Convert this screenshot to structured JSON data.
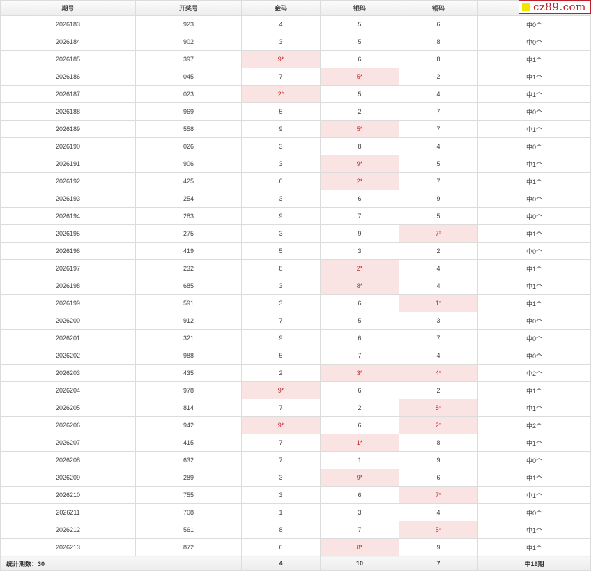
{
  "headers": [
    "期号",
    "开奖号",
    "金码",
    "银码",
    "铜码",
    ""
  ],
  "rows": [
    {
      "issue": "2026183",
      "number": "923",
      "gold": {
        "v": "4",
        "hit": false
      },
      "silver": {
        "v": "5",
        "hit": false
      },
      "bronze": {
        "v": "6",
        "hit": false
      },
      "result": "中0个"
    },
    {
      "issue": "2026184",
      "number": "902",
      "gold": {
        "v": "3",
        "hit": false
      },
      "silver": {
        "v": "5",
        "hit": false
      },
      "bronze": {
        "v": "8",
        "hit": false
      },
      "result": "中0个"
    },
    {
      "issue": "2026185",
      "number": "397",
      "gold": {
        "v": "9*",
        "hit": true
      },
      "silver": {
        "v": "6",
        "hit": false
      },
      "bronze": {
        "v": "8",
        "hit": false
      },
      "result": "中1个"
    },
    {
      "issue": "2026186",
      "number": "045",
      "gold": {
        "v": "7",
        "hit": false
      },
      "silver": {
        "v": "5*",
        "hit": true
      },
      "bronze": {
        "v": "2",
        "hit": false
      },
      "result": "中1个"
    },
    {
      "issue": "2026187",
      "number": "023",
      "gold": {
        "v": "2*",
        "hit": true
      },
      "silver": {
        "v": "5",
        "hit": false
      },
      "bronze": {
        "v": "4",
        "hit": false
      },
      "result": "中1个"
    },
    {
      "issue": "2026188",
      "number": "969",
      "gold": {
        "v": "5",
        "hit": false
      },
      "silver": {
        "v": "2",
        "hit": false
      },
      "bronze": {
        "v": "7",
        "hit": false
      },
      "result": "中0个"
    },
    {
      "issue": "2026189",
      "number": "558",
      "gold": {
        "v": "9",
        "hit": false
      },
      "silver": {
        "v": "5*",
        "hit": true
      },
      "bronze": {
        "v": "7",
        "hit": false
      },
      "result": "中1个"
    },
    {
      "issue": "2026190",
      "number": "026",
      "gold": {
        "v": "3",
        "hit": false
      },
      "silver": {
        "v": "8",
        "hit": false
      },
      "bronze": {
        "v": "4",
        "hit": false
      },
      "result": "中0个"
    },
    {
      "issue": "2026191",
      "number": "906",
      "gold": {
        "v": "3",
        "hit": false
      },
      "silver": {
        "v": "9*",
        "hit": true
      },
      "bronze": {
        "v": "5",
        "hit": false
      },
      "result": "中1个"
    },
    {
      "issue": "2026192",
      "number": "425",
      "gold": {
        "v": "6",
        "hit": false
      },
      "silver": {
        "v": "2*",
        "hit": true
      },
      "bronze": {
        "v": "7",
        "hit": false
      },
      "result": "中1个"
    },
    {
      "issue": "2026193",
      "number": "254",
      "gold": {
        "v": "3",
        "hit": false
      },
      "silver": {
        "v": "6",
        "hit": false
      },
      "bronze": {
        "v": "9",
        "hit": false
      },
      "result": "中0个"
    },
    {
      "issue": "2026194",
      "number": "283",
      "gold": {
        "v": "9",
        "hit": false
      },
      "silver": {
        "v": "7",
        "hit": false
      },
      "bronze": {
        "v": "5",
        "hit": false
      },
      "result": "中0个"
    },
    {
      "issue": "2026195",
      "number": "275",
      "gold": {
        "v": "3",
        "hit": false
      },
      "silver": {
        "v": "9",
        "hit": false
      },
      "bronze": {
        "v": "7*",
        "hit": true
      },
      "result": "中1个"
    },
    {
      "issue": "2026196",
      "number": "419",
      "gold": {
        "v": "5",
        "hit": false
      },
      "silver": {
        "v": "3",
        "hit": false
      },
      "bronze": {
        "v": "2",
        "hit": false
      },
      "result": "中0个"
    },
    {
      "issue": "2026197",
      "number": "232",
      "gold": {
        "v": "8",
        "hit": false
      },
      "silver": {
        "v": "2*",
        "hit": true
      },
      "bronze": {
        "v": "4",
        "hit": false
      },
      "result": "中1个"
    },
    {
      "issue": "2026198",
      "number": "685",
      "gold": {
        "v": "3",
        "hit": false
      },
      "silver": {
        "v": "8*",
        "hit": true
      },
      "bronze": {
        "v": "4",
        "hit": false
      },
      "result": "中1个"
    },
    {
      "issue": "2026199",
      "number": "591",
      "gold": {
        "v": "3",
        "hit": false
      },
      "silver": {
        "v": "6",
        "hit": false
      },
      "bronze": {
        "v": "1*",
        "hit": true
      },
      "result": "中1个"
    },
    {
      "issue": "2026200",
      "number": "912",
      "gold": {
        "v": "7",
        "hit": false
      },
      "silver": {
        "v": "5",
        "hit": false
      },
      "bronze": {
        "v": "3",
        "hit": false
      },
      "result": "中0个"
    },
    {
      "issue": "2026201",
      "number": "321",
      "gold": {
        "v": "9",
        "hit": false
      },
      "silver": {
        "v": "6",
        "hit": false
      },
      "bronze": {
        "v": "7",
        "hit": false
      },
      "result": "中0个"
    },
    {
      "issue": "2026202",
      "number": "988",
      "gold": {
        "v": "5",
        "hit": false
      },
      "silver": {
        "v": "7",
        "hit": false
      },
      "bronze": {
        "v": "4",
        "hit": false
      },
      "result": "中0个"
    },
    {
      "issue": "2026203",
      "number": "435",
      "gold": {
        "v": "2",
        "hit": false
      },
      "silver": {
        "v": "3*",
        "hit": true
      },
      "bronze": {
        "v": "4*",
        "hit": true
      },
      "result": "中2个"
    },
    {
      "issue": "2026204",
      "number": "978",
      "gold": {
        "v": "9*",
        "hit": true
      },
      "silver": {
        "v": "6",
        "hit": false
      },
      "bronze": {
        "v": "2",
        "hit": false
      },
      "result": "中1个"
    },
    {
      "issue": "2026205",
      "number": "814",
      "gold": {
        "v": "7",
        "hit": false
      },
      "silver": {
        "v": "2",
        "hit": false
      },
      "bronze": {
        "v": "8*",
        "hit": true
      },
      "result": "中1个"
    },
    {
      "issue": "2026206",
      "number": "942",
      "gold": {
        "v": "9*",
        "hit": true
      },
      "silver": {
        "v": "6",
        "hit": false
      },
      "bronze": {
        "v": "2*",
        "hit": true
      },
      "result": "中2个"
    },
    {
      "issue": "2026207",
      "number": "415",
      "gold": {
        "v": "7",
        "hit": false
      },
      "silver": {
        "v": "1*",
        "hit": true
      },
      "bronze": {
        "v": "8",
        "hit": false
      },
      "result": "中1个"
    },
    {
      "issue": "2026208",
      "number": "632",
      "gold": {
        "v": "7",
        "hit": false
      },
      "silver": {
        "v": "1",
        "hit": false
      },
      "bronze": {
        "v": "9",
        "hit": false
      },
      "result": "中0个"
    },
    {
      "issue": "2026209",
      "number": "289",
      "gold": {
        "v": "3",
        "hit": false
      },
      "silver": {
        "v": "9*",
        "hit": true
      },
      "bronze": {
        "v": "6",
        "hit": false
      },
      "result": "中1个"
    },
    {
      "issue": "2026210",
      "number": "755",
      "gold": {
        "v": "3",
        "hit": false
      },
      "silver": {
        "v": "6",
        "hit": false
      },
      "bronze": {
        "v": "7*",
        "hit": true
      },
      "result": "中1个"
    },
    {
      "issue": "2026211",
      "number": "708",
      "gold": {
        "v": "1",
        "hit": false
      },
      "silver": {
        "v": "3",
        "hit": false
      },
      "bronze": {
        "v": "4",
        "hit": false
      },
      "result": "中0个"
    },
    {
      "issue": "2026212",
      "number": "561",
      "gold": {
        "v": "8",
        "hit": false
      },
      "silver": {
        "v": "7",
        "hit": false
      },
      "bronze": {
        "v": "5*",
        "hit": true
      },
      "result": "中1个"
    },
    {
      "issue": "2026213",
      "number": "872",
      "gold": {
        "v": "6",
        "hit": false
      },
      "silver": {
        "v": "8*",
        "hit": true
      },
      "bronze": {
        "v": "9",
        "hit": false
      },
      "result": "中1个"
    }
  ],
  "footer": {
    "label": "统计期数：30",
    "number": "",
    "gold": "4",
    "silver": "10",
    "bronze": "7",
    "result": "中19期"
  },
  "logo": {
    "text": "cz89.com"
  },
  "colors": {
    "hit_bg": "#fae3e3",
    "hit_text": "#c0262c",
    "logo_red": "#b9202a",
    "logo_yellow": "#f2e600"
  }
}
